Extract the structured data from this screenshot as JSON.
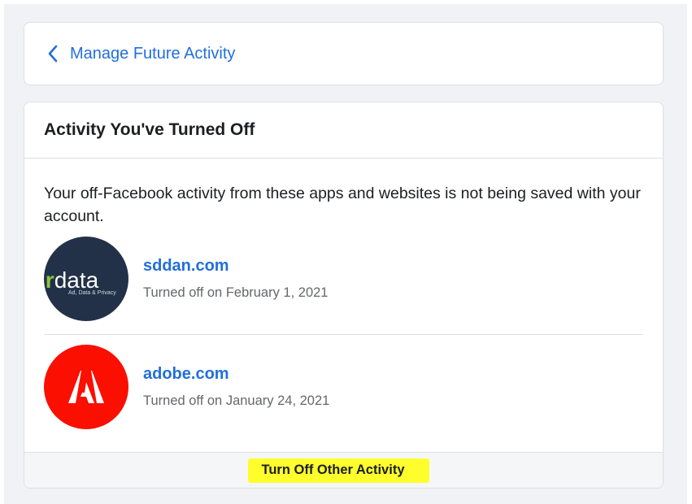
{
  "nav": {
    "back_label": "Manage Future Activity",
    "back_icon": "chevron-left-icon"
  },
  "section": {
    "title": "Activity You've Turned Off",
    "description": "Your off-Facebook activity from these apps and websites is not being saved with your account."
  },
  "apps": [
    {
      "name": "sddan.com",
      "status": "Turned off on February 1, 2021",
      "logo": "sirdata-logo",
      "logo_text": "sirdata",
      "logo_subtext": "Ad, Data & Privacy"
    },
    {
      "name": "adobe.com",
      "status": "Turned off on January 24, 2021",
      "logo": "adobe-logo"
    }
  ],
  "footer": {
    "button_label": "Turn Off Other Activity",
    "highlight_color": "#fefe2d"
  },
  "colors": {
    "link": "#216fdb",
    "adobe_red": "#fa0f00",
    "sirdata_navy": "#233148"
  }
}
